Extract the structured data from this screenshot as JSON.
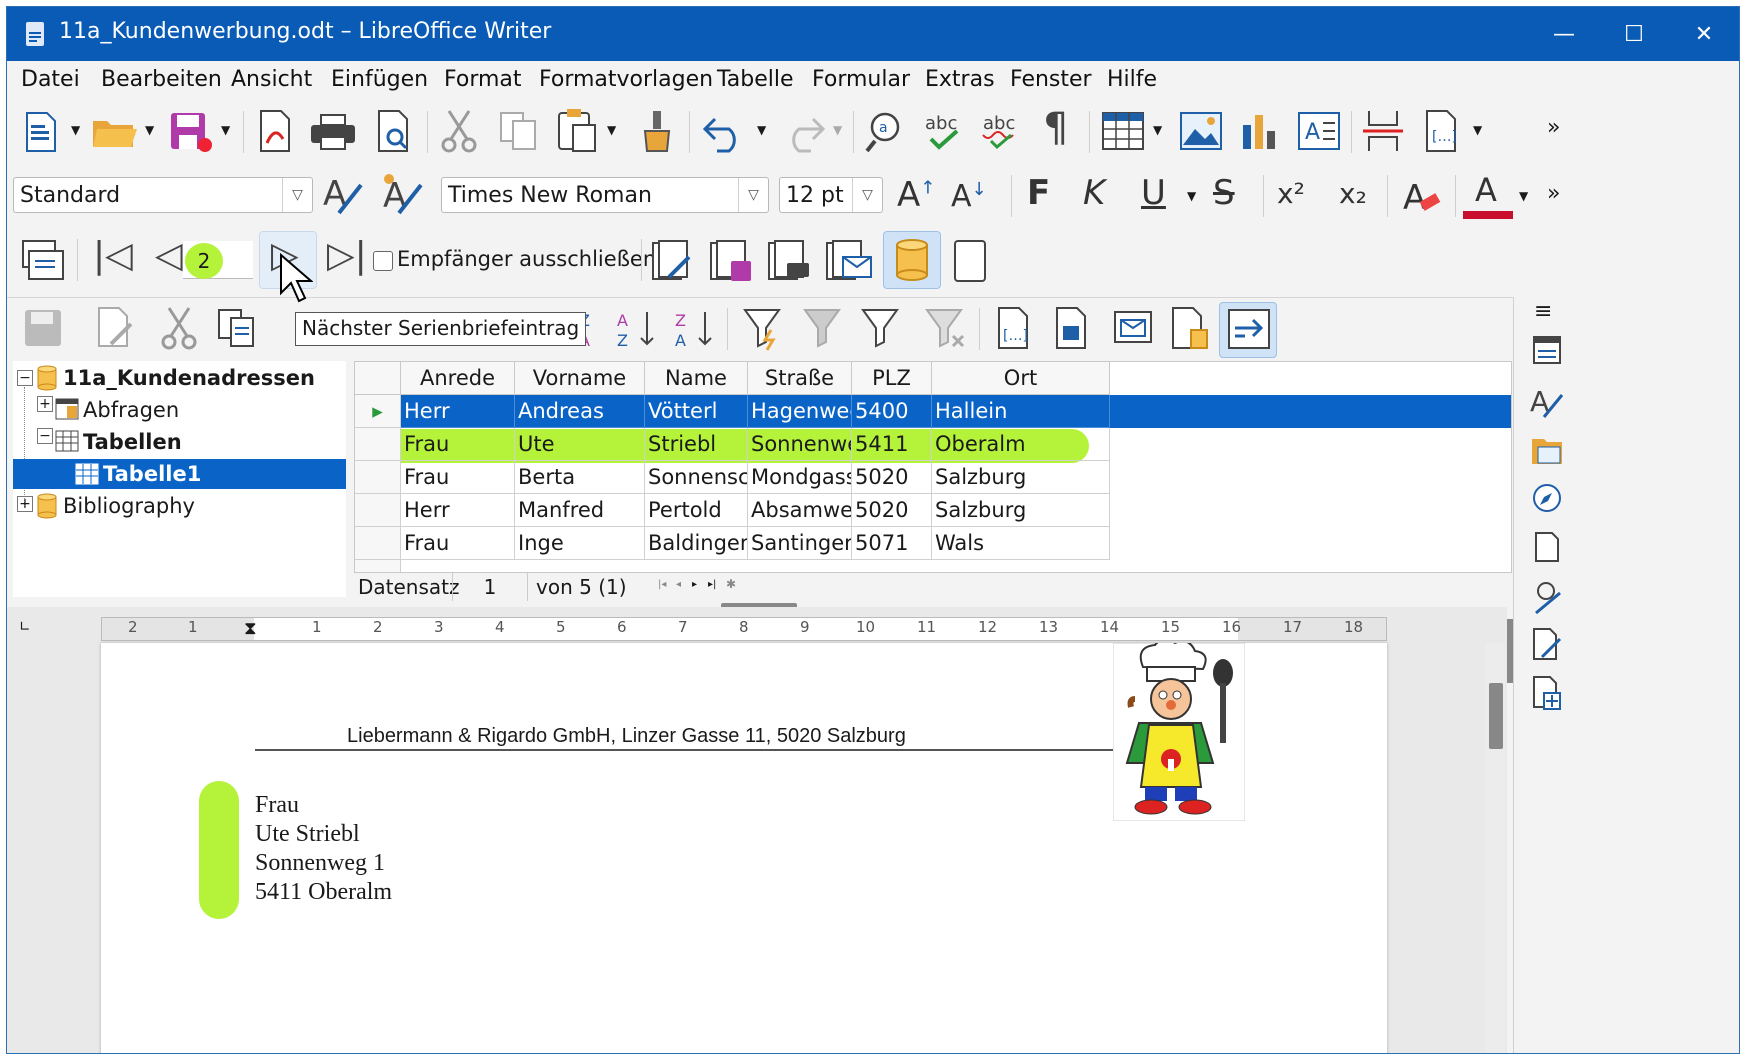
{
  "window": {
    "title": "11a_Kundenwerbung.odt – LibreOffice Writer",
    "minimize": "—",
    "maximize": "☐",
    "close": "✕"
  },
  "menu": [
    "Datei",
    "Bearbeiten",
    "Ansicht",
    "Einfügen",
    "Format",
    "Formatvorlagen",
    "Tabelle",
    "Formular",
    "Extras",
    "Fenster",
    "Hilfe"
  ],
  "formatting": {
    "paragraph_style": "Standard",
    "font_name": "Times New Roman",
    "font_size": "12 pt",
    "bold": "F",
    "italic": "K",
    "underline": "U",
    "strike": "S",
    "superscript": "x²",
    "subscript": "x₂",
    "grow": "A",
    "shrink": "A",
    "font_color_letter": "A",
    "more": "»"
  },
  "mailmerge": {
    "record_number": "2",
    "exclude_recipient_label": "Empfänger ausschließen",
    "exclude_recipient_checked": false
  },
  "tooltip": "Nächster Serienbriefeintrag",
  "datasource_tree": {
    "root": "11a_Kundenadressen",
    "queries": "Abfragen",
    "tables": "Tabellen",
    "table1": "Tabelle1",
    "bibliography": "Bibliography"
  },
  "grid": {
    "columns": [
      "Anrede",
      "Vorname",
      "Name",
      "Straße",
      "PLZ",
      "Ort"
    ],
    "rows": [
      [
        "Herr",
        "Andreas",
        "Vötterl",
        "Hagenweg",
        "5400",
        "Hallein"
      ],
      [
        "Frau",
        "Ute",
        "Striebl",
        "Sonnenwe",
        "5411",
        "Oberalm"
      ],
      [
        "Frau",
        "Berta",
        "Sonnensch",
        "Mondgass",
        "5020",
        "Salzburg"
      ],
      [
        "Herr",
        "Manfred",
        "Pertold",
        "Absamweg",
        "5020",
        "Salzburg"
      ],
      [
        "Frau",
        "Inge",
        "Baldinger",
        "Santingers",
        "5071",
        "Wals"
      ]
    ],
    "selected_row": 0,
    "highlighted_row": 1,
    "record_label": "Datensatz",
    "record_value": "1",
    "record_of": "von 5 (1)"
  },
  "ruler": {
    "numbers": [
      "2",
      "1",
      "1",
      "2",
      "3",
      "4",
      "5",
      "6",
      "7",
      "8",
      "9",
      "10",
      "11",
      "12",
      "13",
      "14",
      "15",
      "16",
      "17",
      "18"
    ]
  },
  "document": {
    "sender_line": "Liebermann & Rigardo GmbH,  Linzer Gasse 11, 5020 Salzburg",
    "address": [
      "Frau",
      "Ute Striebl",
      "Sonnenweg 1",
      "5411 Oberalm"
    ]
  },
  "colors": {
    "titlebar": "#0a5bb5",
    "selection": "#0a64c8",
    "highlighter": "#b5f23a",
    "record_badge": "#b5f23a"
  }
}
